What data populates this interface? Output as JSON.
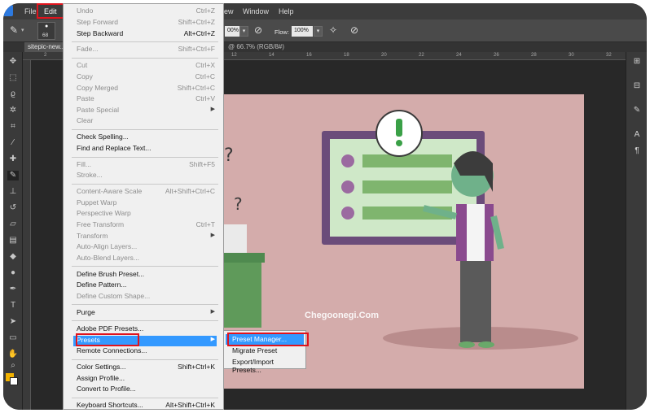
{
  "menubar": {
    "items": [
      "File",
      "Edit",
      "View",
      "Window",
      "Help"
    ],
    "view_label": "iew"
  },
  "options": {
    "brush_size": "68",
    "opacity_value": "00%",
    "flow_label": "Flow:",
    "flow_value": "100%"
  },
  "document": {
    "tab_label": "sitepic-new...",
    "tab_info": "@ 66.7% (RGB/8#)"
  },
  "ruler_ticks": [
    "2",
    "4",
    "6",
    "8",
    "10",
    "12",
    "14",
    "16",
    "18",
    "20",
    "22",
    "24",
    "26",
    "28",
    "30",
    "32"
  ],
  "edit_menu": [
    {
      "label": "Undo",
      "shortcut": "Ctrl+Z",
      "disabled": true
    },
    {
      "label": "Step Forward",
      "shortcut": "Shift+Ctrl+Z",
      "disabled": true
    },
    {
      "label": "Step Backward",
      "shortcut": "Alt+Ctrl+Z",
      "disabled": false
    },
    {
      "label": "Fade...",
      "shortcut": "Shift+Ctrl+F",
      "disabled": true
    },
    {
      "label": "Cut",
      "shortcut": "Ctrl+X",
      "disabled": true
    },
    {
      "label": "Copy",
      "shortcut": "Ctrl+C",
      "disabled": true
    },
    {
      "label": "Copy Merged",
      "shortcut": "Shift+Ctrl+C",
      "disabled": true
    },
    {
      "label": "Paste",
      "shortcut": "Ctrl+V",
      "disabled": true
    },
    {
      "label": "Paste Special",
      "shortcut": "",
      "disabled": true
    },
    {
      "label": "Clear",
      "shortcut": "",
      "disabled": true
    },
    {
      "label": "Check Spelling...",
      "shortcut": "",
      "disabled": false
    },
    {
      "label": "Find and Replace Text...",
      "shortcut": "",
      "disabled": false
    },
    {
      "label": "Fill...",
      "shortcut": "Shift+F5",
      "disabled": true
    },
    {
      "label": "Stroke...",
      "shortcut": "",
      "disabled": true
    },
    {
      "label": "Content-Aware Scale",
      "shortcut": "Alt+Shift+Ctrl+C",
      "disabled": true
    },
    {
      "label": "Puppet Warp",
      "shortcut": "",
      "disabled": true
    },
    {
      "label": "Perspective Warp",
      "shortcut": "",
      "disabled": true
    },
    {
      "label": "Free Transform",
      "shortcut": "Ctrl+T",
      "disabled": true
    },
    {
      "label": "Transform",
      "shortcut": "",
      "disabled": true
    },
    {
      "label": "Auto-Align Layers...",
      "shortcut": "",
      "disabled": true
    },
    {
      "label": "Auto-Blend Layers...",
      "shortcut": "",
      "disabled": true
    },
    {
      "label": "Define Brush Preset...",
      "shortcut": "",
      "disabled": false
    },
    {
      "label": "Define Pattern...",
      "shortcut": "",
      "disabled": false
    },
    {
      "label": "Define Custom Shape...",
      "shortcut": "",
      "disabled": true
    },
    {
      "label": "Purge",
      "shortcut": "",
      "disabled": false
    },
    {
      "label": "Adobe PDF Presets...",
      "shortcut": "",
      "disabled": false
    },
    {
      "label": "Presets",
      "shortcut": "",
      "disabled": false
    },
    {
      "label": "Remote Connections...",
      "shortcut": "",
      "disabled": false
    },
    {
      "label": "Color Settings...",
      "shortcut": "Shift+Ctrl+K",
      "disabled": false
    },
    {
      "label": "Assign Profile...",
      "shortcut": "",
      "disabled": false
    },
    {
      "label": "Convert to Profile...",
      "shortcut": "",
      "disabled": false
    },
    {
      "label": "Keyboard Shortcuts...",
      "shortcut": "Alt+Shift+Ctrl+K",
      "disabled": false
    }
  ],
  "presets_submenu": [
    "Preset Manager...",
    "Migrate Preset",
    "Export/Import Presets..."
  ],
  "watermark": "Chegoonegi.Com",
  "colors": {
    "highlight": "#3399ff",
    "annotation_red": "#e0141d",
    "foreground_swatch": "#f2b200",
    "canvas_bg": "#d4acab"
  }
}
